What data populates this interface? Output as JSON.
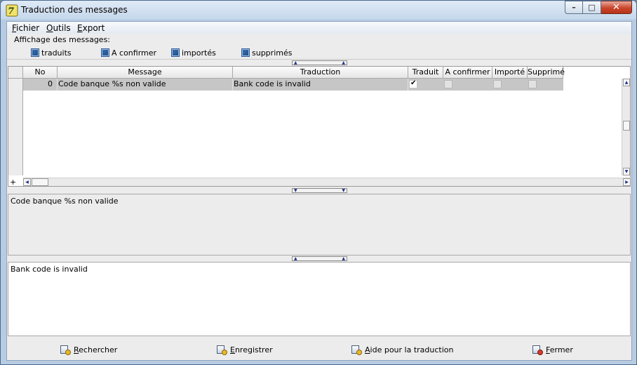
{
  "window": {
    "title": "Traduction des messages"
  },
  "menu": [
    "Fichier",
    "Outils",
    "Export"
  ],
  "filters": {
    "legend": "Affichage des messages:",
    "items": [
      {
        "label": "traduits",
        "checked": true
      },
      {
        "label": "A confirmer",
        "checked": true
      },
      {
        "label": "importés",
        "checked": true
      },
      {
        "label": "supprimés",
        "checked": true
      }
    ]
  },
  "grid": {
    "columns": [
      "No",
      "Message",
      "Traduction",
      "Traduit",
      "A confirmer",
      "Importé",
      "Supprimé"
    ],
    "rows": [
      {
        "no": "0",
        "message": "Code banque %s non valide",
        "traduction": "Bank code is invalid",
        "traduit": true,
        "a_confirmer": false,
        "importe": false,
        "supprime": false
      }
    ],
    "add_row_glyph": "+"
  },
  "message_pane": {
    "text": "Code banque %s non valide"
  },
  "translation_pane": {
    "text": "Bank code is invalid"
  },
  "buttons": {
    "search": "Rechercher",
    "save": "Enregistrer",
    "help": "Aide pour la traduction",
    "close": "Fermer"
  },
  "icons": {
    "app": "app-logo-icon",
    "minimize": "minimize-icon",
    "maximize": "maximize-icon",
    "close": "close-icon"
  }
}
